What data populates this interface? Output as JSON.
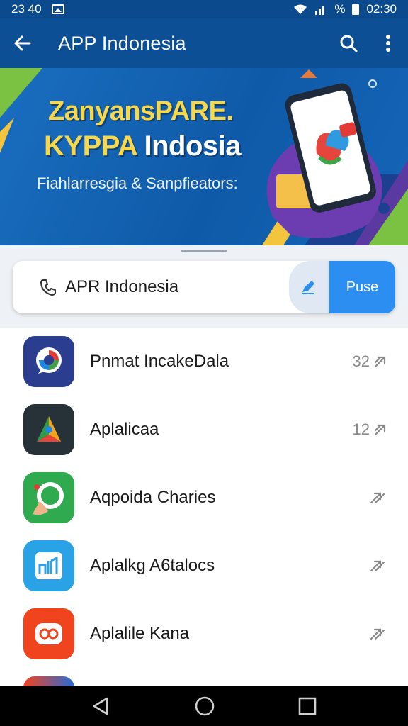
{
  "status_bar": {
    "time_left": "23 40",
    "time_right": "02:30",
    "percent_symbol": "%"
  },
  "app_bar": {
    "title": "APP Indonesia",
    "back_icon": "back-arrow-icon",
    "search_icon": "search-icon",
    "menu_icon": "more-vert-icon"
  },
  "banner": {
    "headline_line1": "ZanyansPARE.",
    "headline_line2_highlight": "KYPPA",
    "headline_line2_rest": " Indosia",
    "subtitle": "Fiahlarresgia & Sanpfieators:"
  },
  "search": {
    "value": "APR Indonesia",
    "button_label": "Puse",
    "phone_icon": "phone-icon",
    "edit_icon": "pen-icon"
  },
  "apps": [
    {
      "label": "Pnmat IncakeDala",
      "count": "32"
    },
    {
      "label": "Aplalicaa",
      "count": "12"
    },
    {
      "label": "Aqpoida  Charies",
      "count": ""
    },
    {
      "label": "Aplalkg A6talocs",
      "count": ""
    },
    {
      "label": "Aplalile Kana",
      "count": ""
    }
  ],
  "colors": {
    "status_bar": "#0b4a8c",
    "app_bar": "#0d4f94",
    "accent": "#2c8ef0",
    "headline_yellow": "#f7d84a"
  },
  "nav": {
    "back": "nav-back-icon",
    "home": "nav-home-icon",
    "recents": "nav-recents-icon"
  }
}
